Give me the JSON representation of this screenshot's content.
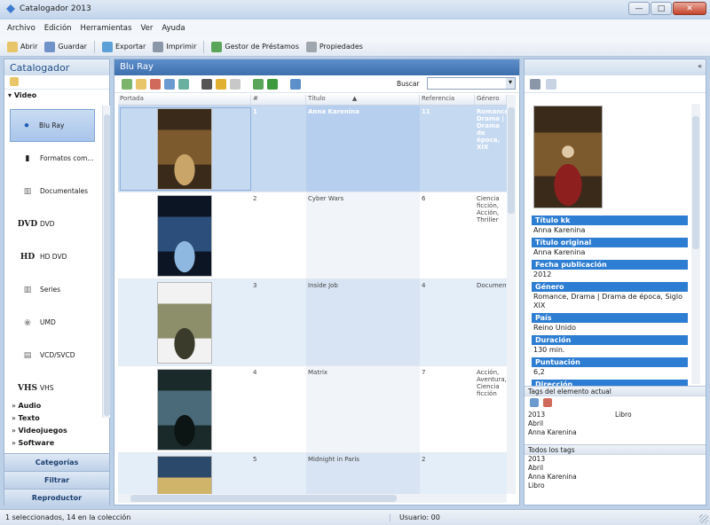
{
  "window": {
    "title": "Catalogador 2013",
    "minimize": "—",
    "maximize": "□",
    "close": "✕"
  },
  "menu": [
    "Archivo",
    "Edición",
    "Herramientas",
    "Ver",
    "Ayuda"
  ],
  "toolbar": {
    "open": "Abrir",
    "save": "Guardar",
    "export": "Exportar",
    "print": "Imprimir",
    "loans": "Gestor de Préstamos",
    "properties": "Propiedades"
  },
  "left": {
    "title": "Catalogador",
    "group": "Video",
    "items": [
      {
        "label": "Blu Ray",
        "icon": "bluray-icon",
        "glyph": "⏺"
      },
      {
        "label": "Formatos com...",
        "icon": "film-icon",
        "glyph": "▮"
      },
      {
        "label": "Documentales",
        "icon": "documentary-icon",
        "glyph": "▥"
      },
      {
        "label": "DVD",
        "icon": "dvd-icon",
        "glyph": "DVD"
      },
      {
        "label": "HD DVD",
        "icon": "hddvd-icon",
        "glyph": "HD"
      },
      {
        "label": "Series",
        "icon": "series-icon",
        "glyph": "▥"
      },
      {
        "label": "UMD",
        "icon": "umd-icon",
        "glyph": "◉"
      },
      {
        "label": "VCD/SVCD",
        "icon": "vcd-icon",
        "glyph": "▤"
      },
      {
        "label": "VHS",
        "icon": "vhs-icon",
        "glyph": "VHS"
      }
    ],
    "categories": [
      "Audio",
      "Texto",
      "Videojuegos",
      "Software"
    ],
    "buttons": {
      "categories": "Categorías",
      "filter": "Filtrar",
      "player": "Reproductor"
    }
  },
  "center": {
    "title": "Blu Ray",
    "search_label": "Buscar",
    "columns": [
      "Portada",
      "#",
      "Título",
      "Referencia",
      "Género"
    ],
    "rows": [
      {
        "num": "1",
        "title": "Anna Karenina",
        "ref": "11",
        "genre": "Romance, Drama | Drama de época, XIX",
        "poster": [
          "#3a2a1a",
          "#7d5a2d",
          "#c9a56a"
        ]
      },
      {
        "num": "2",
        "title": "Cyber Wars",
        "ref": "6",
        "genre": "Ciencia ficción, Acción, Thriller",
        "poster": [
          "#0c1524",
          "#2b4f7a",
          "#8eb8e0"
        ]
      },
      {
        "num": "3",
        "title": "Inside Job",
        "ref": "4",
        "genre": "Documental",
        "poster": [
          "#f2f2f2",
          "#8d8f6a",
          "#3a3b2a"
        ]
      },
      {
        "num": "4",
        "title": "Matrix",
        "ref": "7",
        "genre": "Acción, Aventura, Ciencia ficción",
        "poster": [
          "#1a2a2a",
          "#4a6a7a",
          "#0d1414"
        ]
      },
      {
        "num": "5",
        "title": "Midnight in Paris",
        "ref": "2",
        "genre": "",
        "poster": [
          "#2b4a6b",
          "#d0b46a",
          "#3b6b8e"
        ]
      }
    ]
  },
  "detail": {
    "fields": [
      {
        "label": "Título kk",
        "value": "Anna Karenina"
      },
      {
        "label": "Título original",
        "value": "Anna Karenina"
      },
      {
        "label": "Fecha publicación",
        "value": "2012"
      },
      {
        "label": "Género",
        "value": "Romance, Drama | Drama de época, Siglo XIX"
      },
      {
        "label": "País",
        "value": "Reino Unido"
      },
      {
        "label": "Duración",
        "value": "130 min."
      },
      {
        "label": "Puntuación",
        "value": "6,2"
      },
      {
        "label": "Dirección",
        "value": ""
      }
    ],
    "current_tags_title": "Tags del elemento actual",
    "current_tags": [
      {
        "left": "2013",
        "right": "Libro"
      },
      {
        "left": "Abril",
        "right": ""
      },
      {
        "left": "Anna Karenina",
        "right": ""
      }
    ],
    "all_tags_title": "Todos los tags",
    "all_tags": [
      "2013",
      "Abril",
      "Anna Karenina",
      "Libro"
    ]
  },
  "status": {
    "selection": "1 seleccionados, 14 en la colección",
    "user": "Usuario: 00"
  }
}
